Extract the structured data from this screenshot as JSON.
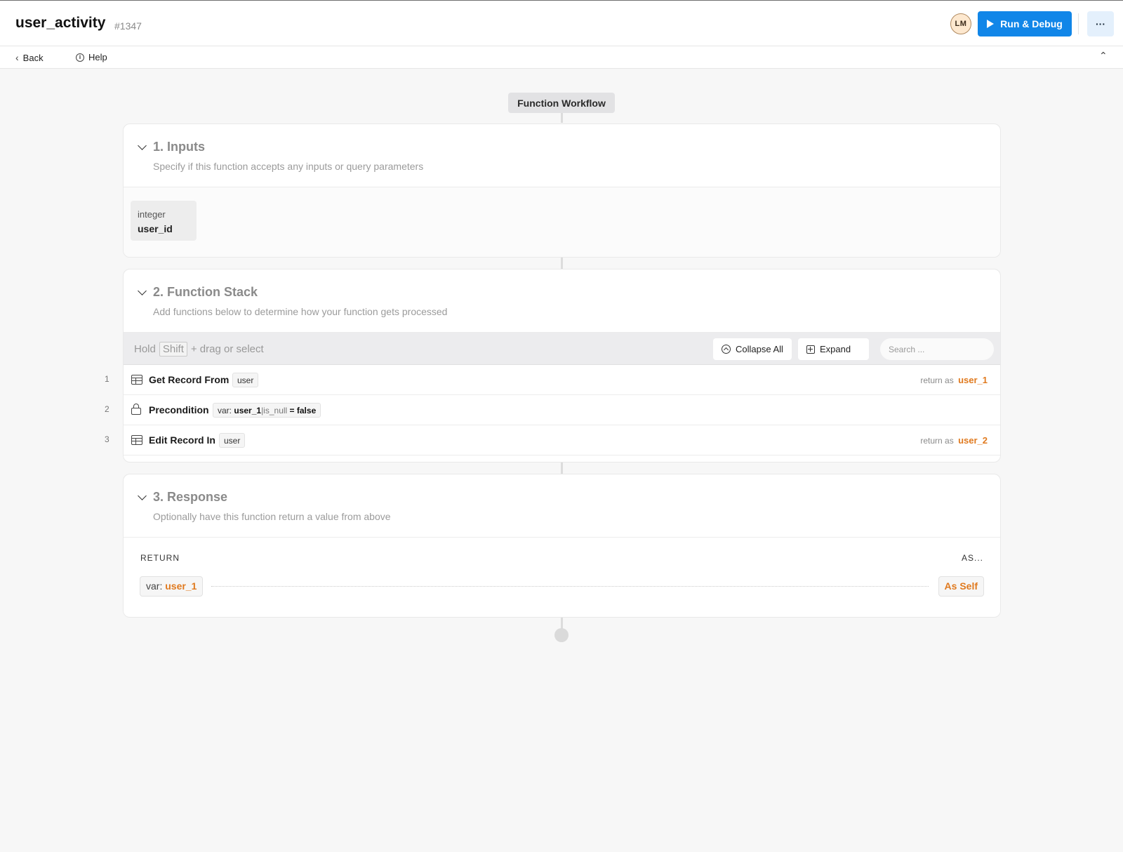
{
  "header": {
    "title": "user_activity",
    "id": "#1347",
    "avatar_initials": "LM",
    "run_label": "Run & Debug",
    "more_label": "···"
  },
  "subnav": {
    "back_label": "Back",
    "help_label": "Help"
  },
  "workflow": {
    "label": "Function Workflow"
  },
  "inputs": {
    "title": "1. Inputs",
    "description": "Specify if this function accepts any inputs or query parameters",
    "items": [
      {
        "type": "integer",
        "name": "user_id"
      }
    ]
  },
  "stack": {
    "title": "2. Function Stack",
    "description": "Add functions below to determine how your function gets processed",
    "hint_prefix": "Hold",
    "hint_key": "Shift",
    "hint_suffix": "+ drag or select",
    "collapse_label": "Collapse All",
    "expand_label": "Expand",
    "search_placeholder": "Search ...",
    "rows": [
      {
        "num": "1",
        "icon": "table-icon",
        "title": "Get Record From",
        "tag": "user",
        "return_prefix": "return as",
        "return_var": "user_1"
      },
      {
        "num": "2",
        "icon": "lock-icon",
        "title": "Precondition",
        "cond_prefix": "var:",
        "cond_var": "user_1",
        "cond_filter": "|is_null",
        "cond_op": "= false"
      },
      {
        "num": "3",
        "icon": "table-icon",
        "title": "Edit Record In",
        "tag": "user",
        "return_prefix": "return as",
        "return_var": "user_2"
      }
    ]
  },
  "response": {
    "title": "3. Response",
    "description": "Optionally have this function return a value from above",
    "return_label": "RETURN",
    "as_label": "AS...",
    "var_prefix": "var:",
    "var_name": "user_1",
    "as_value": "As Self"
  },
  "colors": {
    "accent": "#1186e8",
    "variable": "#e07a1f"
  }
}
